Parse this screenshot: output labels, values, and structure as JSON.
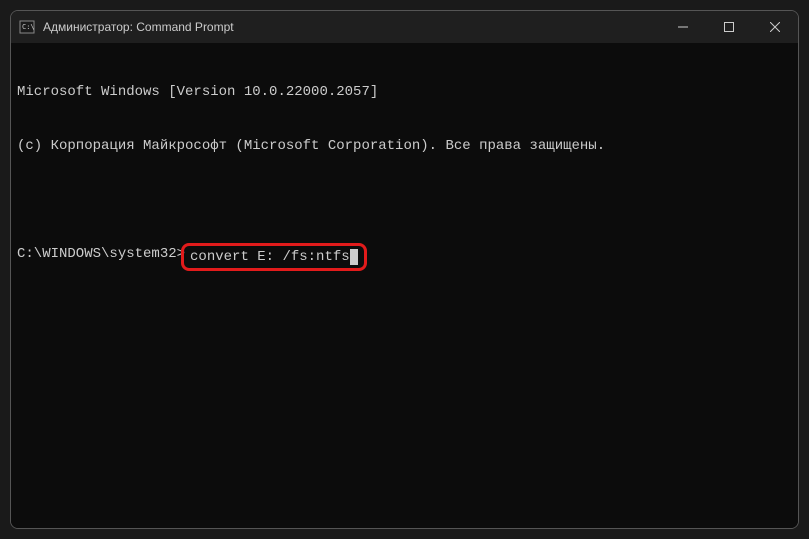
{
  "titlebar": {
    "title": "Администратор: Command Prompt"
  },
  "terminal": {
    "line1": "Microsoft Windows [Version 10.0.22000.2057]",
    "line2": "(c) Корпорация Майкрософт (Microsoft Corporation). Все права защищены.",
    "prompt": "C:\\WINDOWS\\system32>",
    "command": "convert E: /fs:ntfs"
  }
}
